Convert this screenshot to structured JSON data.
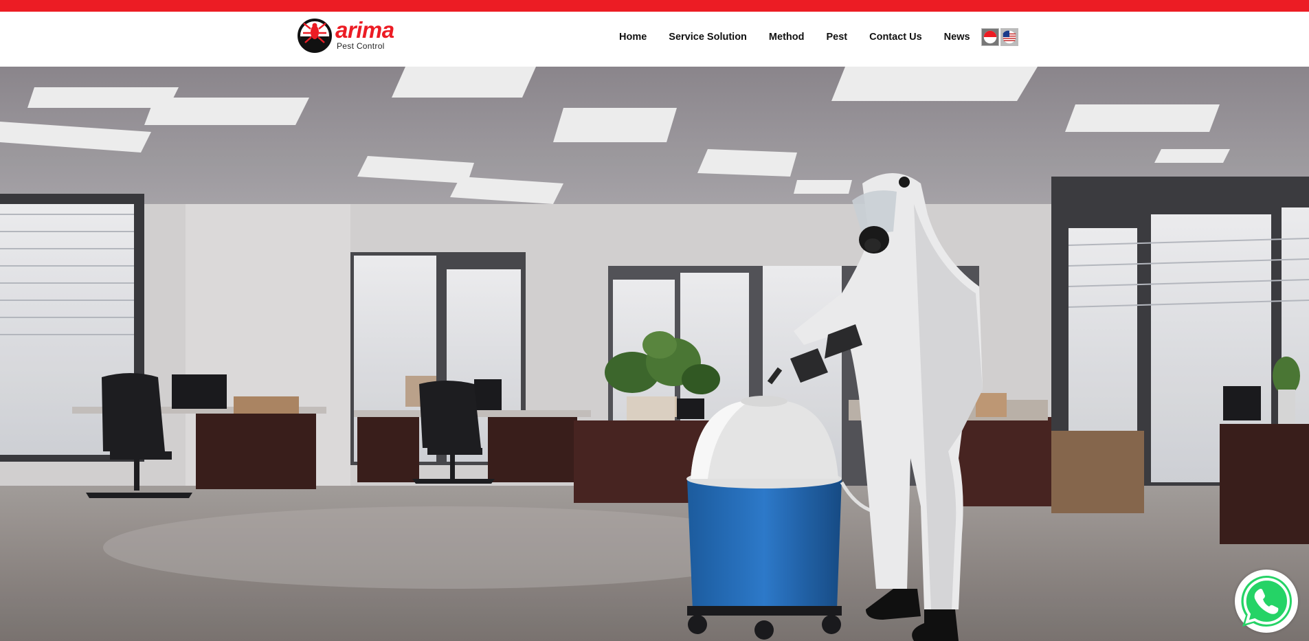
{
  "brand": {
    "name": "arima",
    "tagline": "Pest Control",
    "primary_color": "#ec1c24"
  },
  "nav": {
    "items": [
      {
        "label": "Home"
      },
      {
        "label": "Service Solution"
      },
      {
        "label": "Method"
      },
      {
        "label": "Pest"
      },
      {
        "label": "Contact Us"
      },
      {
        "label": "News"
      }
    ],
    "languages": [
      {
        "icon": "indonesia-flag-icon"
      },
      {
        "icon": "usa-flag-icon"
      }
    ]
  },
  "hero": {
    "image": "office-pest-control-technician-spraying"
  },
  "floating": {
    "icon": "whatsapp-icon",
    "color": "#25d366"
  }
}
